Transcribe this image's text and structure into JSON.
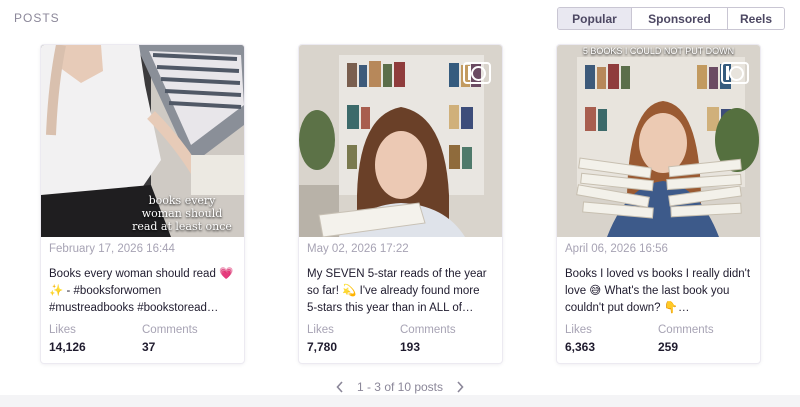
{
  "section": {
    "title": "POSTS"
  },
  "tabs": [
    {
      "label": "Popular",
      "active": true
    },
    {
      "label": "Sponsored",
      "active": false
    },
    {
      "label": "Reels",
      "active": false
    }
  ],
  "posts": [
    {
      "thumb_text": "books every woman should read at least once",
      "date": "February 17, 2026 16:44",
      "caption": "Books every woman should read 💗✨ - #booksforwomen #mustreadbooks #bookstoread…",
      "likes_label": "Likes",
      "likes": "14,126",
      "comments_label": "Comments",
      "comments": "37",
      "reel": false
    },
    {
      "thumb_text": "",
      "date": "May 02, 2026 17:22",
      "caption": "My SEVEN 5-star reads of the year so far! 💫 I've already found more 5-stars this year than in ALL of…",
      "likes_label": "Likes",
      "likes": "7,780",
      "comments_label": "Comments",
      "comments": "193",
      "reel": true
    },
    {
      "thumb_text": "5 BOOKS I COULD NOT PUT DOWN",
      "date": "April 06, 2026 16:56",
      "caption": "Books I loved vs books I really didn't love 😅 What's the last book you couldn't put down? 👇…",
      "likes_label": "Likes",
      "likes": "6,363",
      "comments_label": "Comments",
      "comments": "259",
      "reel": true
    }
  ],
  "pagination": {
    "text": "1 - 3 of 10 posts",
    "prev_icon": "chevron-left-icon",
    "next_icon": "chevron-right-icon"
  },
  "colors": {
    "accent": "#4d4863",
    "muted": "#a7a3b4",
    "text": "#1f1b2e"
  }
}
